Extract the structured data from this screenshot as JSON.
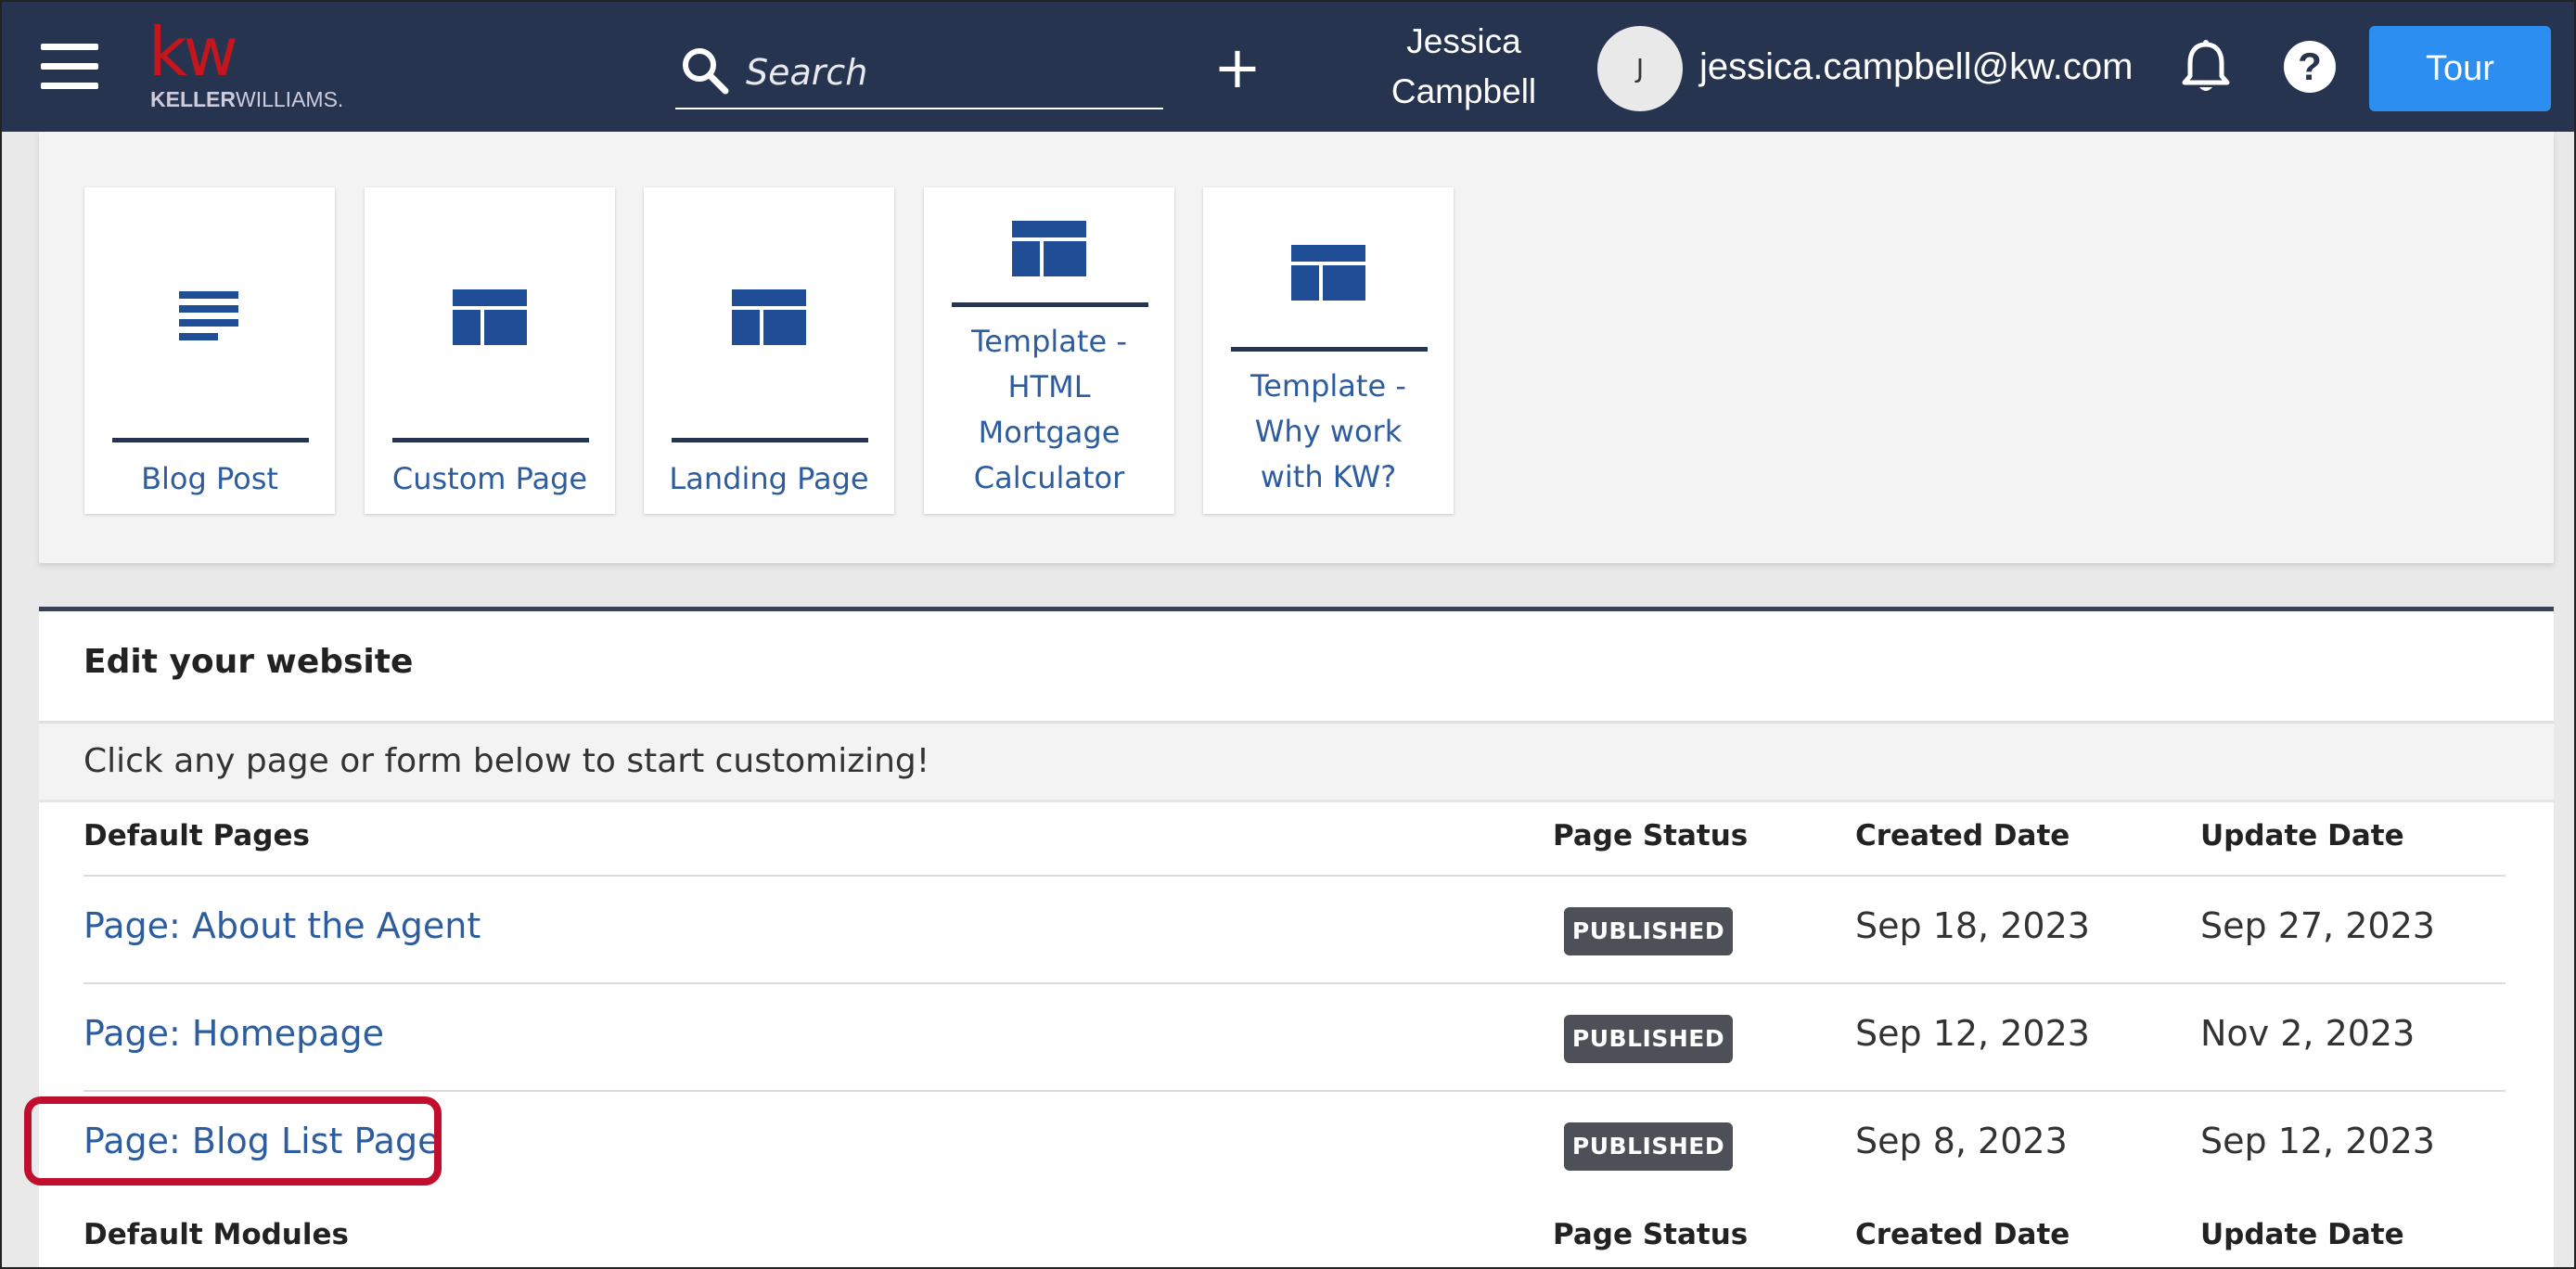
{
  "header": {
    "logo_text": "kw",
    "logo_sub_bold": "KELLER",
    "logo_sub_rest": "WILLIAMS.",
    "search_placeholder": "Search",
    "add_label": "+",
    "user_first": "Jessica",
    "user_last": "Campbell",
    "avatar_initial": "J",
    "email": "jessica.campbell@kw.com",
    "help_label": "?",
    "tour_label": "Tour"
  },
  "templates": [
    {
      "label": "Blog Post",
      "icon": "blog-post-icon"
    },
    {
      "label": "Custom Page",
      "icon": "page-layout-icon"
    },
    {
      "label": "Landing Page",
      "icon": "page-layout-icon"
    },
    {
      "label": "Template - HTML Mortgage Calculator",
      "lines": [
        "Template -",
        "HTML",
        "Mortgage",
        "Calculator"
      ],
      "icon": "page-layout-icon"
    },
    {
      "label": "Template - Why work with KW?",
      "lines": [
        "Template -",
        "Why work",
        "with KW?"
      ],
      "icon": "page-layout-icon"
    }
  ],
  "edit": {
    "title": "Edit your website",
    "subtitle": "Click any page or form below to start customizing!",
    "pages_header": {
      "name": "Default Pages",
      "status": "Page Status",
      "created": "Created Date",
      "updated": "Update Date"
    },
    "pages": [
      {
        "name": "Page: About the Agent",
        "status": "PUBLISHED",
        "created": "Sep 18, 2023",
        "updated": "Sep 27, 2023"
      },
      {
        "name": "Page: Homepage",
        "status": "PUBLISHED",
        "created": "Sep 12, 2023",
        "updated": "Nov 2, 2023"
      },
      {
        "name": "Page: Blog List Page",
        "status": "PUBLISHED",
        "created": "Sep 8, 2023",
        "updated": "Sep 12, 2023"
      }
    ],
    "modules_header": {
      "name": "Default Modules",
      "status": "Page Status",
      "created": "Created Date",
      "updated": "Update Date"
    }
  },
  "colors": {
    "topbar": "#27344f",
    "link": "#2d5d9f",
    "tour_button": "#2b8ef0",
    "highlight": "#c10e2e",
    "badge": "#4d5157"
  }
}
